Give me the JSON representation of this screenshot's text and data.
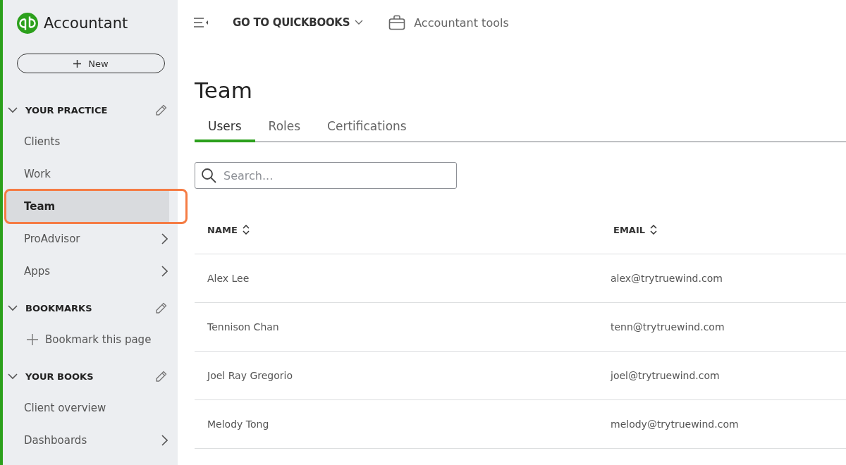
{
  "sidebar": {
    "brand": "Accountant",
    "new_button": "New",
    "sections": [
      {
        "title": "YOUR PRACTICE",
        "expanded": true,
        "items": [
          {
            "label": "Clients",
            "kind": "link",
            "selected": false,
            "submenu": false
          },
          {
            "label": "Work",
            "kind": "link",
            "selected": false,
            "submenu": false
          },
          {
            "label": "Team",
            "kind": "link",
            "selected": true,
            "submenu": false
          },
          {
            "label": "ProAdvisor",
            "kind": "link",
            "selected": false,
            "submenu": true
          },
          {
            "label": "Apps",
            "kind": "link",
            "selected": false,
            "submenu": true
          }
        ]
      },
      {
        "title": "BOOKMARKS",
        "expanded": true,
        "items": [
          {
            "label": "Bookmark this page",
            "kind": "add",
            "selected": false,
            "submenu": false
          }
        ]
      },
      {
        "title": "YOUR BOOKS",
        "expanded": true,
        "items": [
          {
            "label": "Client overview",
            "kind": "link",
            "selected": false,
            "submenu": false
          },
          {
            "label": "Dashboards",
            "kind": "link",
            "selected": false,
            "submenu": true
          }
        ]
      }
    ]
  },
  "topbar": {
    "menu": "GO TO QUICKBOOKS",
    "tools": "Accountant tools"
  },
  "page": {
    "title": "Team",
    "tabs": [
      {
        "label": "Users",
        "selected": true
      },
      {
        "label": "Roles",
        "selected": false
      },
      {
        "label": "Certifications",
        "selected": false
      }
    ],
    "search": {
      "placeholder": "Search..."
    },
    "table": {
      "columns": [
        {
          "label": "NAME"
        },
        {
          "label": "EMAIL"
        }
      ],
      "rows": [
        {
          "cells": [
            "Alex Lee",
            "alex@trytruewind.com"
          ]
        },
        {
          "cells": [
            "Tennison Chan",
            "tenn@trytruewind.com"
          ]
        },
        {
          "cells": [
            "Joel Ray Gregorio",
            "joel@trytruewind.com"
          ]
        },
        {
          "cells": [
            "Melody Tong",
            "melody@trytruewind.com"
          ]
        }
      ]
    }
  }
}
